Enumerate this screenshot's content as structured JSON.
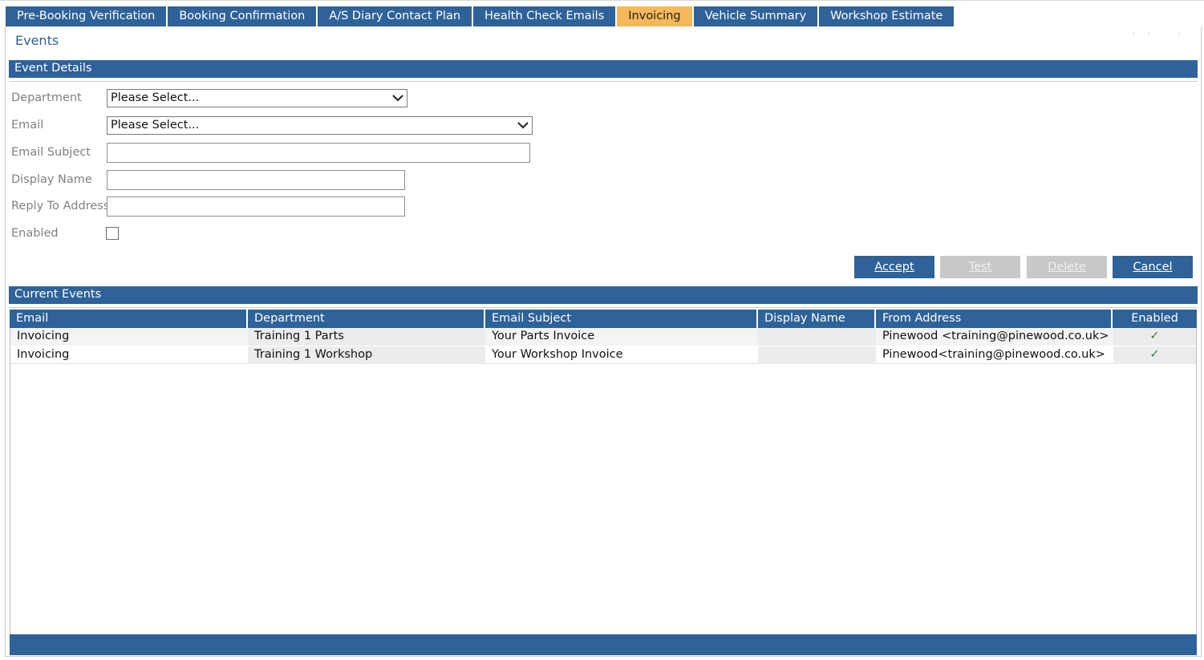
{
  "tabs": [
    {
      "label": "Pre-Booking Verification",
      "active": false
    },
    {
      "label": "Booking Confirmation",
      "active": false
    },
    {
      "label": "A/S Diary Contact Plan",
      "active": false
    },
    {
      "label": "Health Check Emails",
      "active": false
    },
    {
      "label": "Invoicing",
      "active": true
    },
    {
      "label": "Vehicle Summary",
      "active": false
    },
    {
      "label": "Workshop Estimate",
      "active": false
    }
  ],
  "page_title": "Events",
  "event_details": {
    "section_title": "Event Details",
    "department": {
      "label": "Department",
      "value": "Please Select..."
    },
    "email": {
      "label": "Email",
      "value": "Please Select..."
    },
    "email_subject": {
      "label": "Email Subject",
      "value": ""
    },
    "display_name": {
      "label": "Display Name",
      "value": ""
    },
    "reply_to": {
      "label": "Reply To Address",
      "value": ""
    },
    "enabled": {
      "label": "Enabled",
      "checked": false
    }
  },
  "buttons": {
    "accept": "Accept",
    "test": "Test",
    "delete": "Delete",
    "cancel": "Cancel"
  },
  "current_events": {
    "section_title": "Current Events",
    "columns": [
      "Email",
      "Department",
      "Email Subject",
      "Display Name",
      "From Address",
      "Enabled"
    ],
    "rows": [
      {
        "email": "Invoicing",
        "department": "Training 1 Parts",
        "subject": "Your Parts Invoice",
        "display_name": "",
        "from": "Pinewood <training@pinewood.co.uk>",
        "enabled": "✓"
      },
      {
        "email": "Invoicing",
        "department": "Training 1 Workshop",
        "subject": "Your Workshop Invoice",
        "display_name": "",
        "from": "Pinewood<training@pinewood.co.uk>",
        "enabled": "✓"
      }
    ]
  },
  "colors": {
    "primary": "#2e6299",
    "active_tab": "#f6b858",
    "check": "#2e8b2e"
  }
}
